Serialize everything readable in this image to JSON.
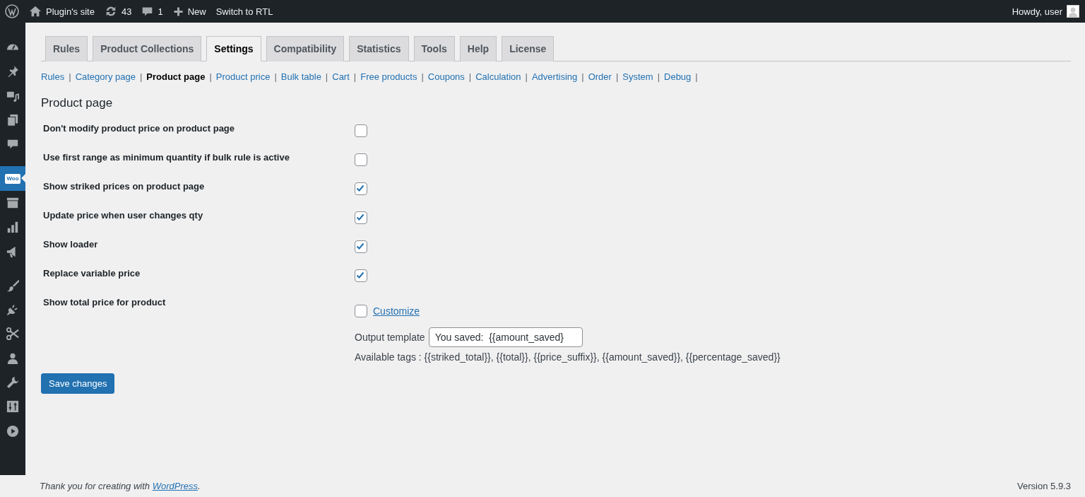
{
  "admin_bar": {
    "site": "Plugin's site",
    "updates": "43",
    "comments": "1",
    "new": "New",
    "rtl": "Switch to RTL",
    "greeting": "Howdy, user"
  },
  "sidebar": [
    {
      "kind": "gauge",
      "selected": false
    },
    {
      "kind": "pin",
      "selected": false
    },
    {
      "kind": "media",
      "selected": false
    },
    {
      "kind": "pages",
      "selected": false
    },
    {
      "kind": "comment",
      "selected": false
    },
    {
      "kind": "woo",
      "label": "Woo",
      "selected": true
    },
    {
      "kind": "archive",
      "selected": false
    },
    {
      "kind": "bars",
      "selected": false
    },
    {
      "kind": "megaphone",
      "selected": false
    },
    {
      "kind": "brush",
      "selected": false
    },
    {
      "kind": "plug",
      "selected": false
    },
    {
      "kind": "scissors",
      "selected": false
    },
    {
      "kind": "person",
      "selected": false
    },
    {
      "kind": "wrench",
      "selected": false
    },
    {
      "kind": "sliders",
      "selected": false
    },
    {
      "kind": "play",
      "selected": false
    }
  ],
  "tabs": [
    {
      "label": "Rules",
      "selected": false
    },
    {
      "label": "Product Collections",
      "selected": false
    },
    {
      "label": "Settings",
      "selected": true
    },
    {
      "label": "Compatibility",
      "selected": false
    },
    {
      "label": "Statistics",
      "selected": false
    },
    {
      "label": "Tools",
      "selected": false
    },
    {
      "label": "Help",
      "selected": false
    },
    {
      "label": "License",
      "selected": false
    }
  ],
  "subnav": [
    {
      "label": "Rules",
      "selected": false
    },
    {
      "label": "Category page",
      "selected": false
    },
    {
      "label": "Product page",
      "selected": true
    },
    {
      "label": "Product price",
      "selected": false
    },
    {
      "label": "Bulk table",
      "selected": false
    },
    {
      "label": "Cart",
      "selected": false
    },
    {
      "label": "Free products",
      "selected": false
    },
    {
      "label": "Coupons",
      "selected": false
    },
    {
      "label": "Calculation",
      "selected": false
    },
    {
      "label": "Advertising",
      "selected": false
    },
    {
      "label": "Order",
      "selected": false
    },
    {
      "label": "System",
      "selected": false
    },
    {
      "label": "Debug",
      "selected": false
    }
  ],
  "subnav_separator": "|",
  "heading": "Product page",
  "settings": [
    {
      "label": "Don't modify product price on product page",
      "checked": false
    },
    {
      "label": "Use first range as minimum quantity if bulk rule is active",
      "checked": false
    },
    {
      "label": "Show striked prices on product page",
      "checked": true
    },
    {
      "label": "Update price when user changes qty",
      "checked": true
    },
    {
      "label": "Show loader",
      "checked": true
    },
    {
      "label": "Replace variable price",
      "checked": true
    },
    {
      "label": "Show total price for product",
      "checked": false,
      "link": "Customize",
      "output_label": "Output template",
      "output_value": "You saved:  {{amount_saved}",
      "tags": "Available tags : {{striked_total}}, {{total}}, {{price_suffix}}, {{amount_saved}}, {{percentage_saved}}"
    }
  ],
  "save_button": "Save changes",
  "footer": {
    "text": "Thank you for creating with ",
    "link": "WordPress",
    "end": ".",
    "version": "Version 5.9.3"
  }
}
